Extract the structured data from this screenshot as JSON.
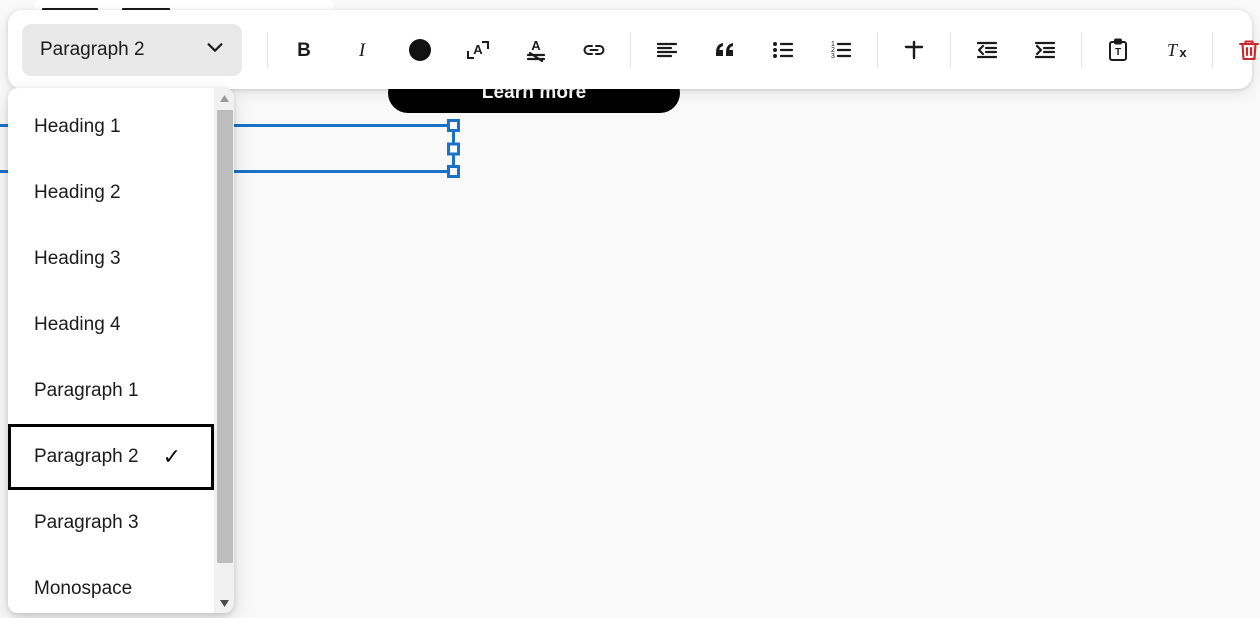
{
  "canvas": {
    "learn_more_label": "Learn more",
    "selection": {
      "color": "#1a73c8",
      "handles": [
        "top-left",
        "middle-left",
        "bottom-left",
        "top-right",
        "middle-right",
        "bottom-right"
      ]
    }
  },
  "toolbar": {
    "style_select": {
      "value": "Paragraph 2",
      "chevron_icon": "chevron-down-icon"
    },
    "buttons": [
      {
        "name": "bold-button",
        "icon": "bold-icon",
        "label": "Bold"
      },
      {
        "name": "italic-button",
        "icon": "italic-icon",
        "label": "Italic"
      },
      {
        "name": "text-color-button",
        "icon": "filled-circle-icon",
        "label": "Text color"
      },
      {
        "name": "font-size-button",
        "icon": "font-size-icon",
        "label": "Font size"
      },
      {
        "name": "text-highlight-button",
        "icon": "text-underline-icon",
        "label": "Highlight"
      },
      {
        "name": "insert-link-button",
        "icon": "link-icon",
        "label": "Insert link"
      },
      {
        "name": "align-button",
        "icon": "align-left-icon",
        "label": "Align"
      },
      {
        "name": "blockquote-button",
        "icon": "quote-icon",
        "label": "Blockquote"
      },
      {
        "name": "bulleted-list-button",
        "icon": "bullet-list-icon",
        "label": "Bulleted list"
      },
      {
        "name": "numbered-list-button",
        "icon": "numbered-list-icon",
        "label": "Numbered list"
      },
      {
        "name": "horizontal-rule-button",
        "icon": "horizontal-rule-icon",
        "label": "Horizontal rule"
      },
      {
        "name": "outdent-button",
        "icon": "outdent-icon",
        "label": "Decrease indent"
      },
      {
        "name": "indent-button",
        "icon": "indent-icon",
        "label": "Increase indent"
      },
      {
        "name": "paste-as-text-button",
        "icon": "clipboard-text-icon",
        "label": "Paste as text"
      },
      {
        "name": "clear-formatting-button",
        "icon": "clear-format-icon",
        "label": "Clear formatting"
      },
      {
        "name": "delete-button",
        "icon": "trash-icon",
        "label": "Delete",
        "color": "#c92a2a"
      }
    ]
  },
  "dropdown": {
    "selected": "Paragraph 2",
    "check_glyph": "✓",
    "items": [
      {
        "label": "Heading 1",
        "selected": false
      },
      {
        "label": "Heading 2",
        "selected": false
      },
      {
        "label": "Heading 3",
        "selected": false
      },
      {
        "label": "Heading 4",
        "selected": false
      },
      {
        "label": "Paragraph 1",
        "selected": false
      },
      {
        "label": "Paragraph 2",
        "selected": true
      },
      {
        "label": "Paragraph 3",
        "selected": false
      },
      {
        "label": "Monospace",
        "selected": false
      }
    ],
    "scrollbar": {
      "up_arrow_icon": "scroll-up-arrow-icon",
      "down_arrow_icon": "scroll-down-arrow-icon"
    }
  }
}
